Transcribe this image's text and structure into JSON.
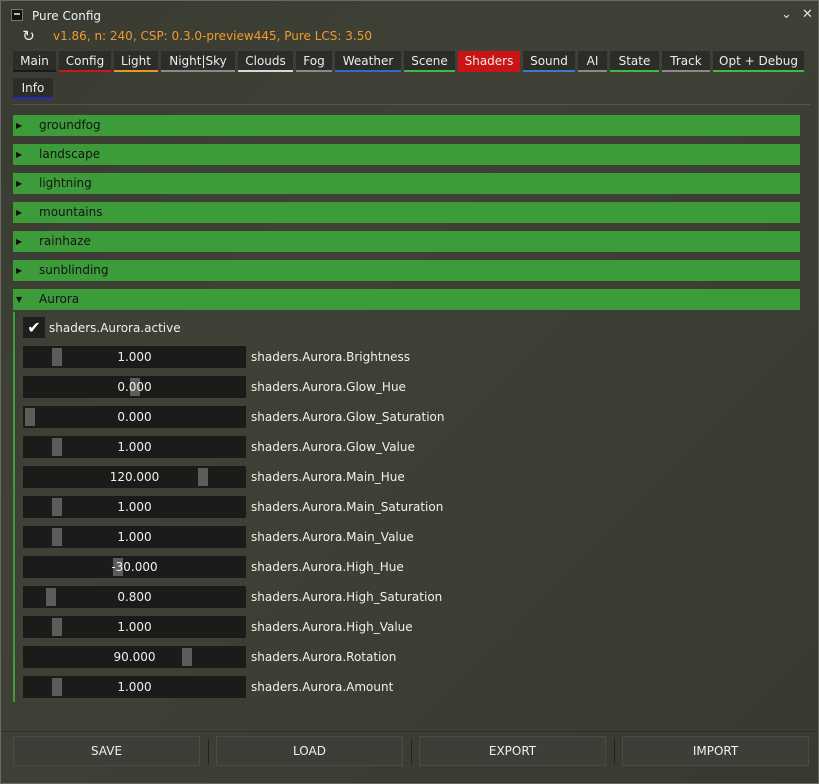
{
  "window": {
    "title": "Pure Config",
    "minimize_glyph": "⌄",
    "close_glyph": "✕"
  },
  "header": {
    "reset_icon": "↻",
    "version": "v1.86, n: 240, CSP: 0.3.0-preview445, Pure LCS: 3.50"
  },
  "tabs": [
    {
      "label": "Main",
      "color": "#1a1a1a",
      "active": false
    },
    {
      "label": "Config",
      "color": "#c81818",
      "active": false
    },
    {
      "label": "Light",
      "color": "#e89a20",
      "active": false
    },
    {
      "label": "Night|Sky",
      "color": "#8a8a8a",
      "active": false
    },
    {
      "label": "Clouds",
      "color": "#d8d8d8",
      "active": false
    },
    {
      "label": "Fog",
      "color": "#8a8a8a",
      "active": false
    },
    {
      "label": "Weather",
      "color": "#2e6bc2",
      "active": false
    },
    {
      "label": "Scene",
      "color": "#44b844",
      "active": false
    },
    {
      "label": "Shaders",
      "color": "#c81414",
      "active": true
    },
    {
      "label": "Sound",
      "color": "#3e78c8",
      "active": false
    },
    {
      "label": "AI",
      "color": "#8a8a8a",
      "active": false
    },
    {
      "label": "State",
      "color": "#44b844",
      "active": false
    },
    {
      "label": "Track",
      "color": "#8a8a8a",
      "active": false
    },
    {
      "label": "Opt + Debug",
      "color": "#44b844",
      "active": false
    },
    {
      "label": "Info",
      "color": "#2828c8",
      "active": false
    }
  ],
  "sections": [
    {
      "label": "groundfog",
      "expanded": false
    },
    {
      "label": "landscape",
      "expanded": false
    },
    {
      "label": "lightning",
      "expanded": false
    },
    {
      "label": "mountains",
      "expanded": false
    },
    {
      "label": "rainhaze",
      "expanded": false
    },
    {
      "label": "sunblinding",
      "expanded": false
    },
    {
      "label": "Aurora",
      "expanded": true
    }
  ],
  "section_arrows": {
    "collapsed": "▶",
    "expanded": "▼"
  },
  "aurora": {
    "active_label": "shaders.Aurora.active",
    "active_checked": true,
    "check_glyph": "✔",
    "sliders": [
      {
        "value": "1.000",
        "label": "shaders.Aurora.Brightness",
        "grab_fraction": 0.13
      },
      {
        "value": "0.000",
        "label": "shaders.Aurora.Glow_Hue",
        "grab_fraction": 0.5
      },
      {
        "value": "0.000",
        "label": "shaders.Aurora.Glow_Saturation",
        "grab_fraction": 0.0
      },
      {
        "value": "1.000",
        "label": "shaders.Aurora.Glow_Value",
        "grab_fraction": 0.13
      },
      {
        "value": "120.000",
        "label": "shaders.Aurora.Main_Hue",
        "grab_fraction": 0.83
      },
      {
        "value": "1.000",
        "label": "shaders.Aurora.Main_Saturation",
        "grab_fraction": 0.13
      },
      {
        "value": "1.000",
        "label": "shaders.Aurora.Main_Value",
        "grab_fraction": 0.13
      },
      {
        "value": "-30.000",
        "label": "shaders.Aurora.High_Hue",
        "grab_fraction": 0.42
      },
      {
        "value": "0.800",
        "label": "shaders.Aurora.High_Saturation",
        "grab_fraction": 0.1
      },
      {
        "value": "1.000",
        "label": "shaders.Aurora.High_Value",
        "grab_fraction": 0.13
      },
      {
        "value": "90.000",
        "label": "shaders.Aurora.Rotation",
        "grab_fraction": 0.75
      },
      {
        "value": "1.000",
        "label": "shaders.Aurora.Amount",
        "grab_fraction": 0.13
      }
    ]
  },
  "footer": {
    "save": "SAVE",
    "load": "LOAD",
    "export": "EXPORT",
    "import": "IMPORT"
  }
}
